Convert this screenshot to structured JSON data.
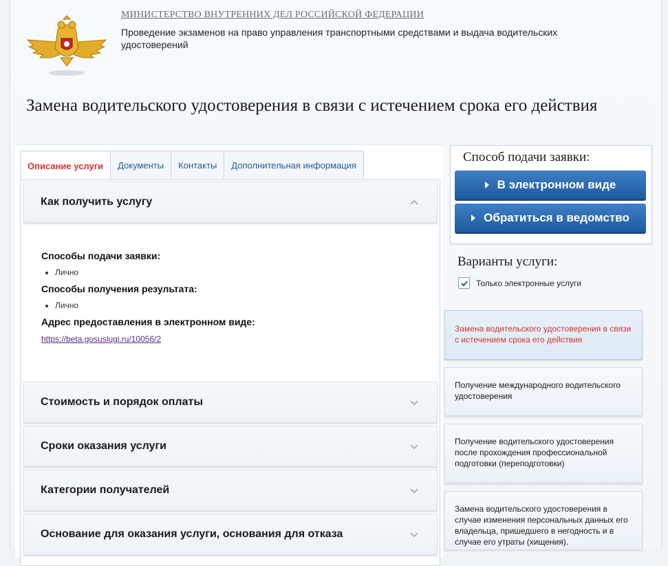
{
  "header": {
    "ministry": "МИНИСТЕРСТВО ВНУТРЕННИХ ДЕЛ РОССИЙСКОЙ ФЕДЕРАЦИИ",
    "subtitle": "Проведение экзаменов на право управления транспортными средствами и выдача водительских удостоверений"
  },
  "service_title": "Замена водительского удостоверения в связи с истечением срока его действия",
  "tabs": [
    {
      "label": "Описание услуги",
      "active": true
    },
    {
      "label": "Документы",
      "active": false
    },
    {
      "label": "Контакты",
      "active": false
    },
    {
      "label": "Дополнительная информация",
      "active": false
    }
  ],
  "accordion": [
    {
      "title": "Как получить услугу",
      "expanded": true
    },
    {
      "title": "Стоимость и порядок оплаты",
      "expanded": false
    },
    {
      "title": "Сроки оказания услуги",
      "expanded": false
    },
    {
      "title": "Категории получателей",
      "expanded": false
    },
    {
      "title": "Основание для оказания услуги, основания для отказа",
      "expanded": false
    }
  ],
  "how_to": {
    "submit_label": "Способы подачи заявки:",
    "submit_items": [
      "Лично"
    ],
    "result_label": "Способы получения результата:",
    "result_items": [
      "Лично"
    ],
    "address_label": "Адрес предоставления в электронном виде:",
    "address_link": "https://beta.gosuslugi.ru/10056/2"
  },
  "apply": {
    "title": "Способ подачи заявки:",
    "electronic_button": "В электронном виде",
    "office_button": "Обратиться в ведомство"
  },
  "variants": {
    "title": "Варианты услуги:",
    "only_electronic_label": "Только электронные услуги",
    "only_electronic_checked": true
  },
  "service_variants": [
    {
      "label": "Замена водительского удостоверения в связи с истечением срока его действия",
      "active": true
    },
    {
      "label": "Получение международного водительского удостоверения",
      "active": false
    },
    {
      "label": "Получение водительского удостоверения после прохождения профессиональной подготовки (переподготовки)",
      "active": false
    },
    {
      "label": "Замена водительского удостоверения в случае изменения персональных данных его владельца, пришедшего в негодность и в случае его утраты (хищения).",
      "active": false
    }
  ],
  "colors": {
    "accent_red": "#d9332c",
    "link_blue": "#1f5c99",
    "button_blue": "#2a68b0",
    "emblem_gold": "#d8a21c"
  }
}
